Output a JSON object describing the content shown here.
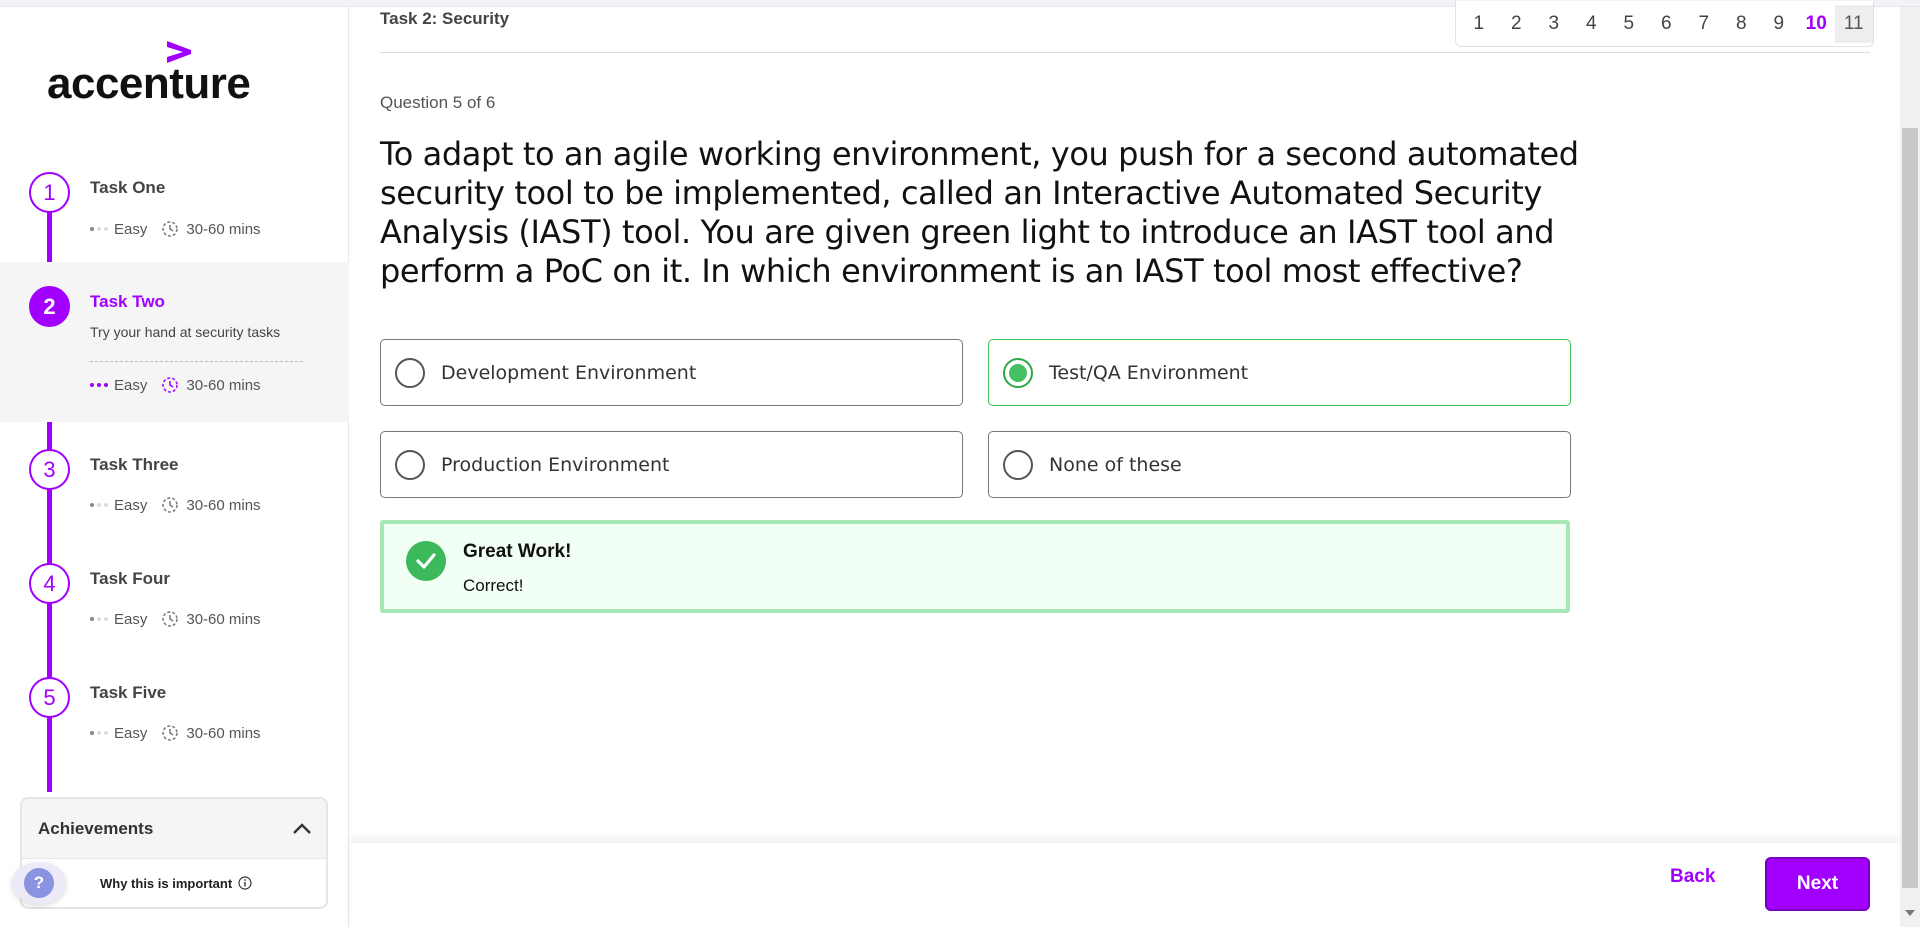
{
  "brand": {
    "name": "accenture",
    "accent": "#a100ff"
  },
  "sidebar": {
    "steps": [
      {
        "number": "1",
        "title": "Task One",
        "difficulty": "Easy",
        "duration": "30-60 mins"
      },
      {
        "number": "2",
        "title": "Task Two",
        "description": "Try your hand at security tasks",
        "difficulty": "Easy",
        "duration": "30-60 mins",
        "active": true
      },
      {
        "number": "3",
        "title": "Task Three",
        "difficulty": "Easy",
        "duration": "30-60 mins"
      },
      {
        "number": "4",
        "title": "Task Four",
        "difficulty": "Easy",
        "duration": "30-60 mins"
      },
      {
        "number": "5",
        "title": "Task Five",
        "difficulty": "Easy",
        "duration": "30-60 mins"
      }
    ],
    "achievements": {
      "title": "Achievements",
      "why_label": "Why this is important"
    },
    "help": "?"
  },
  "header": {
    "task_label": "Task 2: Security",
    "pages": [
      "1",
      "2",
      "3",
      "4",
      "5",
      "6",
      "7",
      "8",
      "9",
      "10",
      "11"
    ],
    "current_page": "10"
  },
  "question": {
    "counter": "Question 5 of 6",
    "text": "To adapt to an agile working environment, you push for a second automated security tool to be implemented, called an Interactive Automated Security Analysis (IAST) tool. You are given green light to introduce an IAST tool and perform a PoC on it. In which environment is an IAST tool most effective?",
    "options": [
      {
        "label": "Development Environment",
        "selected": false
      },
      {
        "label": "Test/QA Environment",
        "selected": true
      },
      {
        "label": "Production Environment",
        "selected": false
      },
      {
        "label": "None of these",
        "selected": false
      }
    ]
  },
  "feedback": {
    "title": "Great Work!",
    "message": "Correct!",
    "color": "#3cb95a"
  },
  "footer": {
    "back_label": "Back",
    "next_label": "Next"
  }
}
